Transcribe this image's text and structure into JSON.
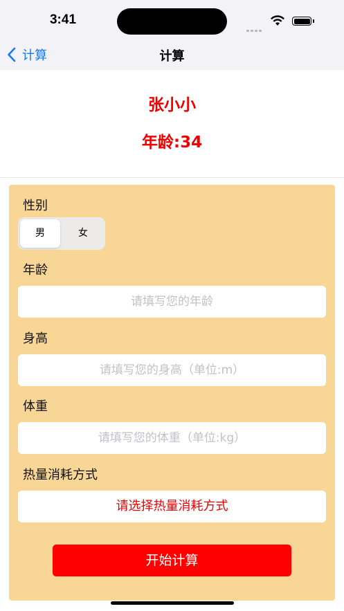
{
  "status_bar": {
    "time": "3:41"
  },
  "nav": {
    "back_label": "计算",
    "title": "计算"
  },
  "profile": {
    "name": "张小小",
    "age_text": "年龄:34"
  },
  "form": {
    "gender_label": "性别",
    "gender_options": [
      "男",
      "女"
    ],
    "gender_selected": "男",
    "age_label": "年龄",
    "age_placeholder": "请填写您的年龄",
    "height_label": "身高",
    "height_placeholder": "请填写您的身高（单位:m）",
    "weight_label": "体重",
    "weight_placeholder": "请填写您的体重（单位:kg）",
    "method_label": "热量消耗方式",
    "method_button": "请选择热量消耗方式",
    "start_button": "开始计算"
  },
  "colors": {
    "accent_red": "#ee0000",
    "card_bg": "#f7d696",
    "link_blue": "#1479f6"
  }
}
